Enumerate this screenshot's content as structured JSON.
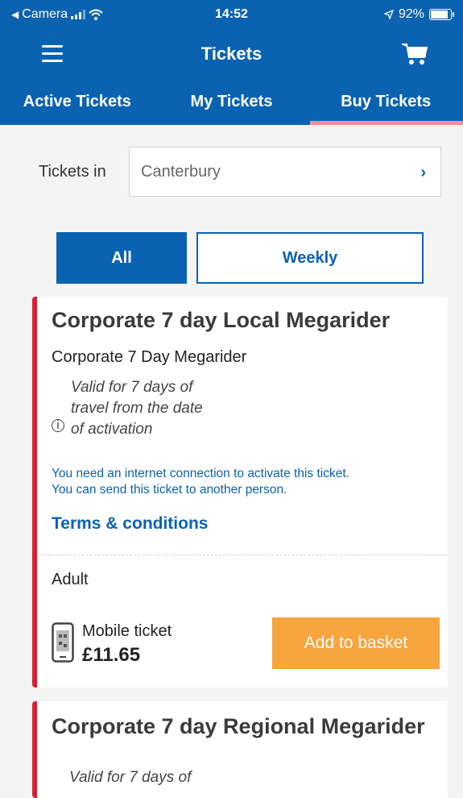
{
  "status_bar": {
    "back_app": "Camera",
    "time": "14:52",
    "battery": "92%"
  },
  "header": {
    "title": "Tickets"
  },
  "tabs": [
    {
      "label": "Active Tickets",
      "active": false
    },
    {
      "label": "My Tickets",
      "active": false
    },
    {
      "label": "Buy Tickets",
      "active": true
    }
  ],
  "location": {
    "label": "Tickets in",
    "value": "Canterbury"
  },
  "filters": {
    "all_label": "All",
    "weekly_label": "Weekly",
    "selected": "All"
  },
  "tickets": [
    {
      "title": "Corporate 7 day Local Megarider",
      "subtitle": "Corporate 7 Day Megarider",
      "validity_lines": [
        "Valid for 7 days of",
        "travel from the date",
        "of activation"
      ],
      "notice_1": "You need an internet connection to activate this ticket.",
      "notice_2": "You can send this ticket to another person.",
      "terms_label": "Terms & conditions",
      "passenger_type": "Adult",
      "ticket_kind": "Mobile ticket",
      "price": "£11.65",
      "add_label": "Add to basket"
    },
    {
      "title": "Corporate 7 day Regional Megarider",
      "validity_first_line": "Valid for 7 days of"
    }
  ],
  "colors": {
    "brand_blue": "#0a62b1",
    "accent_red": "#d91f34",
    "tab_indicator": "#f58ba0",
    "cta_orange": "#f7a53e"
  },
  "icons": [
    "back-arrow-icon",
    "signal-icon",
    "wifi-icon",
    "location-arrow-icon",
    "battery-icon",
    "menu-icon",
    "cart-icon",
    "chevron-right-icon",
    "info-icon",
    "mobile-ticket-icon"
  ]
}
